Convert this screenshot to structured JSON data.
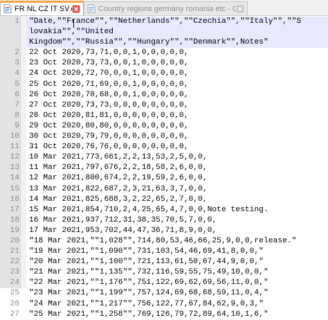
{
  "tabs": [
    {
      "label": "FR NL CZ IT SV.csv",
      "active": true
    },
    {
      "label": "Country regions germany romania etc - Copy.csv",
      "active": false
    }
  ],
  "icons": {
    "file": "document-icon",
    "close": "close-icon"
  },
  "colors": {
    "active_tab_accent": "#f7a64a",
    "current_line": "#e8e8ff",
    "gutter": "#e4e4e4",
    "close_icon": "#d9534f"
  },
  "gutter_numbers": [
    "1",
    "",
    "",
    "2",
    "3",
    "4",
    "5",
    "6",
    "7",
    "8",
    "9",
    "10",
    "11",
    "12",
    "13",
    "14",
    "15",
    "16",
    "17",
    "18",
    "19",
    "20",
    "21",
    "22",
    "23",
    "24",
    "25",
    "26",
    "27"
  ],
  "lines": [
    "\"Date,\"\"France\"\",\"\"Netherlands\"\",\"\"Czechia\"\",\"\"Italy\"\",\"\"S",
    "lovakia\"\",\"\"United",
    "Kingdom\"\",\"\"Russia\"\",\"\"Hungary\"\",\"\"Denmark\"\",Notes\"",
    "22 Oct 2020,73,71,0,0,1,0,0,0,0,0,",
    "23 Oct 2020,73,73,0,0,1,0,0,0,0,0,",
    "24 Oct 2020,72,70,0,0,1,0,0,0,0,0,",
    "25 Oct 2020,71,69,0,0,1,0,0,0,0,0,",
    "26 Oct 2020,70,68,0,0,1,0,0,0,0,0,",
    "27 Oct 2020,73,73,0,0,0,0,0,0,0,0,",
    "28 Oct 2020,81,81,0,0,0,0,0,0,0,0,",
    "29 Oct 2020,80,80,0,0,0,0,0,0,0,0,",
    "30 Oct 2020,79,79,0,0,0,0,0,0,0,0,",
    "31 Oct 2020,76,76,0,0,0,0,0,0,0,0,",
    "10 Mar 2021,773,661,2,2,13,53,2,5,0,0,",
    "11 Mar 2021,797,676,2,2,18,58,2,6,0,0,",
    "12 Mar 2021,800,674,2,2,19,59,2,6,0,0,",
    "13 Mar 2021,822,687,2,3,21,63,3,7,0,0,",
    "14 Mar 2021,825,688,3,2,22,65,2,7,0,0,",
    "15 Mar 2021,854,710,2,4,25,65,4,7,0,0,Note testing.",
    "16 Mar 2021,937,712,31,38,35,70,5,7,0,0,",
    "17 Mar 2021,953,702,44,47,36,71,8,9,0,0,",
    "\"18 Mar 2021,\"\"1,028\"\",714,80,53,46,66,25,9,0,0,release.\"",
    "\"19 Mar 2021,\"\"1,090\"\",731,103,54,46,69,41,8,0,0,\"",
    "\"20 Mar 2021,\"\"1,100\"\",721,113,61,50,67,44,9,0,0,\"",
    "\"21 Mar 2021,\"\"1,135\"\",732,116,59,55,75,49,10,0,0,\"",
    "\"22 Mar 2021,\"\"1,176\"\",751,122,69,62,69,56,11,0,0,\"",
    "\"23 Mar 2021,\"\"1,199\"\",757,124,69,68,68,59,11,0,4,\"",
    "\"24 Mar 2021,\"\"1,217\"\",756,122,77,67,84,62,9,0,3,\"",
    "\"25 Mar 2021,\"\"1,258\"\",769,126,79,72,89,64,10,1,6,\""
  ]
}
